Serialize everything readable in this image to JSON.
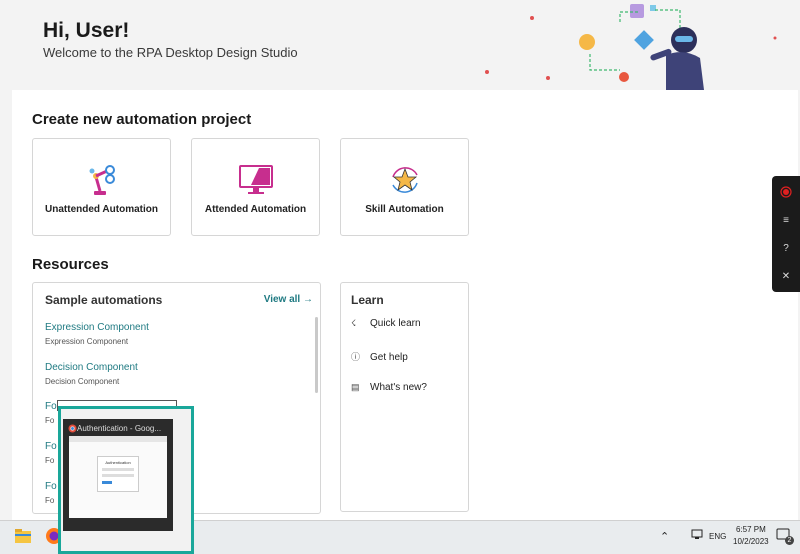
{
  "header": {
    "greeting": "Hi, User!",
    "welcome": "Welcome to the RPA Desktop Design Studio"
  },
  "create_section": {
    "title": "Create new automation project",
    "cards": [
      {
        "label": "Unattended Automation",
        "icon": "robot-arm-icon"
      },
      {
        "label": "Attended Automation",
        "icon": "monitor-icon"
      },
      {
        "label": "Skill Automation",
        "icon": "star-cycle-icon"
      }
    ]
  },
  "resources": {
    "title": "Resources",
    "samples": {
      "title": "Sample automations",
      "view_all": "View all →",
      "items": [
        {
          "name": "Expression Component",
          "sub": "Expression Component"
        },
        {
          "name": "Decision Component",
          "sub": "Decision Component"
        },
        {
          "name": "Fo",
          "sub": "Fo"
        },
        {
          "name": "Fo",
          "sub": "Fo"
        },
        {
          "name": "Fo",
          "sub": "Fo"
        }
      ]
    },
    "learn": {
      "title": "Learn",
      "items": [
        {
          "label": "Quick learn",
          "icon": "bolt-icon"
        },
        {
          "label": "Get help",
          "icon": "help-circle-icon"
        },
        {
          "label": "What's new?",
          "icon": "news-icon"
        }
      ]
    }
  },
  "taskbar": {
    "preview_title": "Authentication - Goog...",
    "preview_page_heading": "Authentication",
    "language": "ENG",
    "time": "6:57 PM",
    "date": "10/2/2023",
    "notification_count": "2"
  },
  "colors": {
    "accent": "#1f7a82",
    "preview_border": "#1aa79a",
    "record": "#e02020"
  }
}
